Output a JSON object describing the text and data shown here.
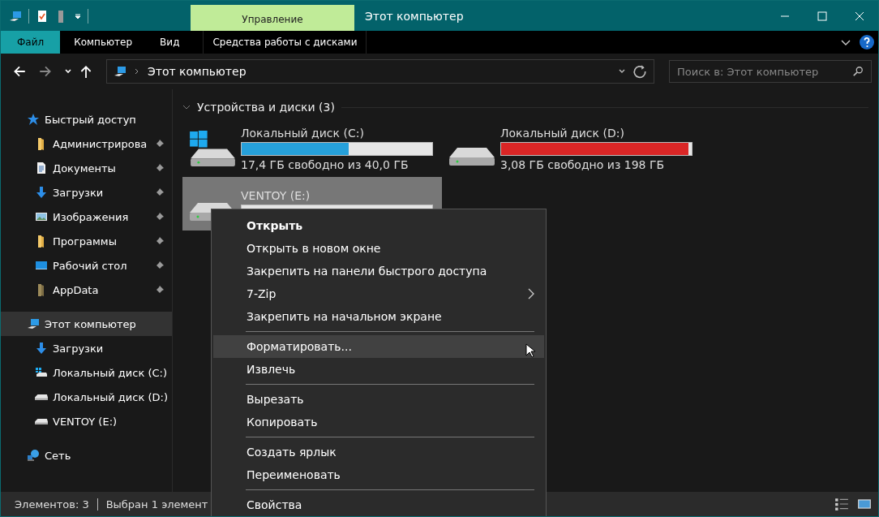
{
  "window": {
    "title": "Этот компьютер",
    "context_tab": "Управление"
  },
  "ribbon_tabs": [
    {
      "label": "Файл",
      "selected": true
    },
    {
      "label": "Компьютер",
      "selected": false
    },
    {
      "label": "Вид",
      "selected": false
    },
    {
      "label": "Средства работы с дисками",
      "selected": false
    }
  ],
  "address": {
    "path": "Этот компьютер"
  },
  "search": {
    "placeholder": "Поиск в: Этот компьютер"
  },
  "sidebar": [
    {
      "label": "Быстрый доступ",
      "kind": "star",
      "selected": false,
      "children": [
        {
          "label": "Администрирова",
          "kind": "folder",
          "pinned": true,
          "selected": false
        },
        {
          "label": "Документы",
          "kind": "document",
          "pinned": true,
          "selected": false
        },
        {
          "label": "Загрузки",
          "kind": "download",
          "pinned": true,
          "selected": false
        },
        {
          "label": "Изображения",
          "kind": "image",
          "pinned": true,
          "selected": false
        },
        {
          "label": "Программы",
          "kind": "folder",
          "pinned": true,
          "selected": false
        },
        {
          "label": "Рабочий стол",
          "kind": "desktop",
          "pinned": true,
          "selected": false
        },
        {
          "label": "AppData",
          "kind": "darkfolder",
          "pinned": true,
          "selected": false
        }
      ]
    },
    {
      "label": "Этот компьютер",
      "kind": "computer",
      "selected": true,
      "children": [
        {
          "label": "Загрузки",
          "kind": "download",
          "pinned": false,
          "selected": false
        },
        {
          "label": "Локальный диск (C:)",
          "kind": "windrive",
          "pinned": false,
          "selected": false
        },
        {
          "label": "Локальный диск (D:)",
          "kind": "drive",
          "pinned": false,
          "selected": false
        },
        {
          "label": "VENTOY (E:)",
          "kind": "drive",
          "pinned": false,
          "selected": false
        }
      ]
    },
    {
      "label": "Сеть",
      "kind": "network",
      "selected": false
    }
  ],
  "section": {
    "title": "Устройства и диски (3)"
  },
  "drives": [
    {
      "name": "Локальный диск (C:)",
      "kind": "windrive",
      "level": 0.56,
      "low_space": false,
      "free": "17,4 ГБ свободно из 40,0 ГБ",
      "selected": false
    },
    {
      "name": "Локальный диск (D:)",
      "kind": "drive",
      "level": 0.984,
      "low_space": true,
      "free": "3,08 ГБ свободно из 198 ГБ",
      "selected": false
    },
    {
      "name": "VENTOY (E:)",
      "kind": "drive",
      "selected": true
    }
  ],
  "context_menu": [
    {
      "kind": "item",
      "label": "Открыть",
      "bold": true,
      "submenu": false,
      "selected": false
    },
    {
      "kind": "item",
      "label": "Открыть в новом окне",
      "bold": false,
      "submenu": false,
      "selected": false
    },
    {
      "kind": "item",
      "label": "Закрепить на панели быстрого доступа",
      "bold": false,
      "submenu": false,
      "selected": false
    },
    {
      "kind": "item",
      "label": "7-Zip",
      "bold": false,
      "submenu": true,
      "selected": false
    },
    {
      "kind": "item",
      "label": "Закрепить на начальном экране",
      "bold": false,
      "submenu": false,
      "selected": false
    },
    {
      "kind": "separator"
    },
    {
      "kind": "item",
      "label": "Форматировать...",
      "bold": false,
      "submenu": false,
      "selected": true
    },
    {
      "kind": "item",
      "label": "Извлечь",
      "bold": false,
      "submenu": false,
      "selected": false
    },
    {
      "kind": "separator"
    },
    {
      "kind": "item",
      "label": "Вырезать",
      "bold": false,
      "submenu": false,
      "selected": false
    },
    {
      "kind": "item",
      "label": "Копировать",
      "bold": false,
      "submenu": false,
      "selected": false
    },
    {
      "kind": "separator"
    },
    {
      "kind": "item",
      "label": "Создать ярлык",
      "bold": false,
      "submenu": false,
      "selected": false
    },
    {
      "kind": "item",
      "label": "Переименовать",
      "bold": false,
      "submenu": false,
      "selected": false
    },
    {
      "kind": "separator"
    },
    {
      "kind": "item",
      "label": "Свойства",
      "bold": false,
      "submenu": false,
      "selected": false
    }
  ],
  "status_bar": {
    "count": "Элементов: 3",
    "selection": "Выбран 1 элемент"
  }
}
